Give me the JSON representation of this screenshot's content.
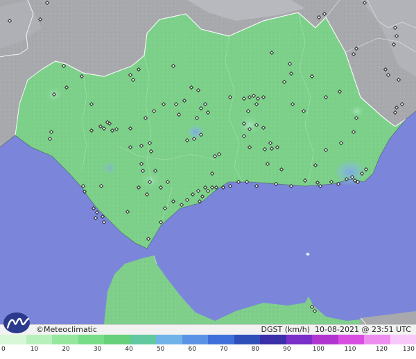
{
  "footer": {
    "brand": "©Meteoclimatic",
    "variable": "DGST (km/h)",
    "date": "10-08-2021",
    "at": "@",
    "time": "23:51 UTC"
  },
  "scale": {
    "labels": [
      "0",
      "10",
      "20",
      "30",
      "40",
      "50",
      "60",
      "70",
      "80",
      "90",
      "100",
      "110",
      "120",
      "130"
    ],
    "min": 0,
    "max": 130,
    "colors": [
      "#d8f7d8",
      "#b8f0bc",
      "#95e79e",
      "#77dd87",
      "#66d17a",
      "#62c8a0",
      "#6fb3e8",
      "#5a93e6",
      "#3f6fdb",
      "#2f4fb8",
      "#3a2fa8",
      "#7a2fc8",
      "#b034d0",
      "#d84ee0",
      "#ee8df0",
      "#f8c9f8"
    ]
  },
  "colors": {
    "sea": "#7b86da",
    "land_outside": "#a7a9ad",
    "andalusia": "#7cd089",
    "morocco": "#7fcf8b"
  }
}
